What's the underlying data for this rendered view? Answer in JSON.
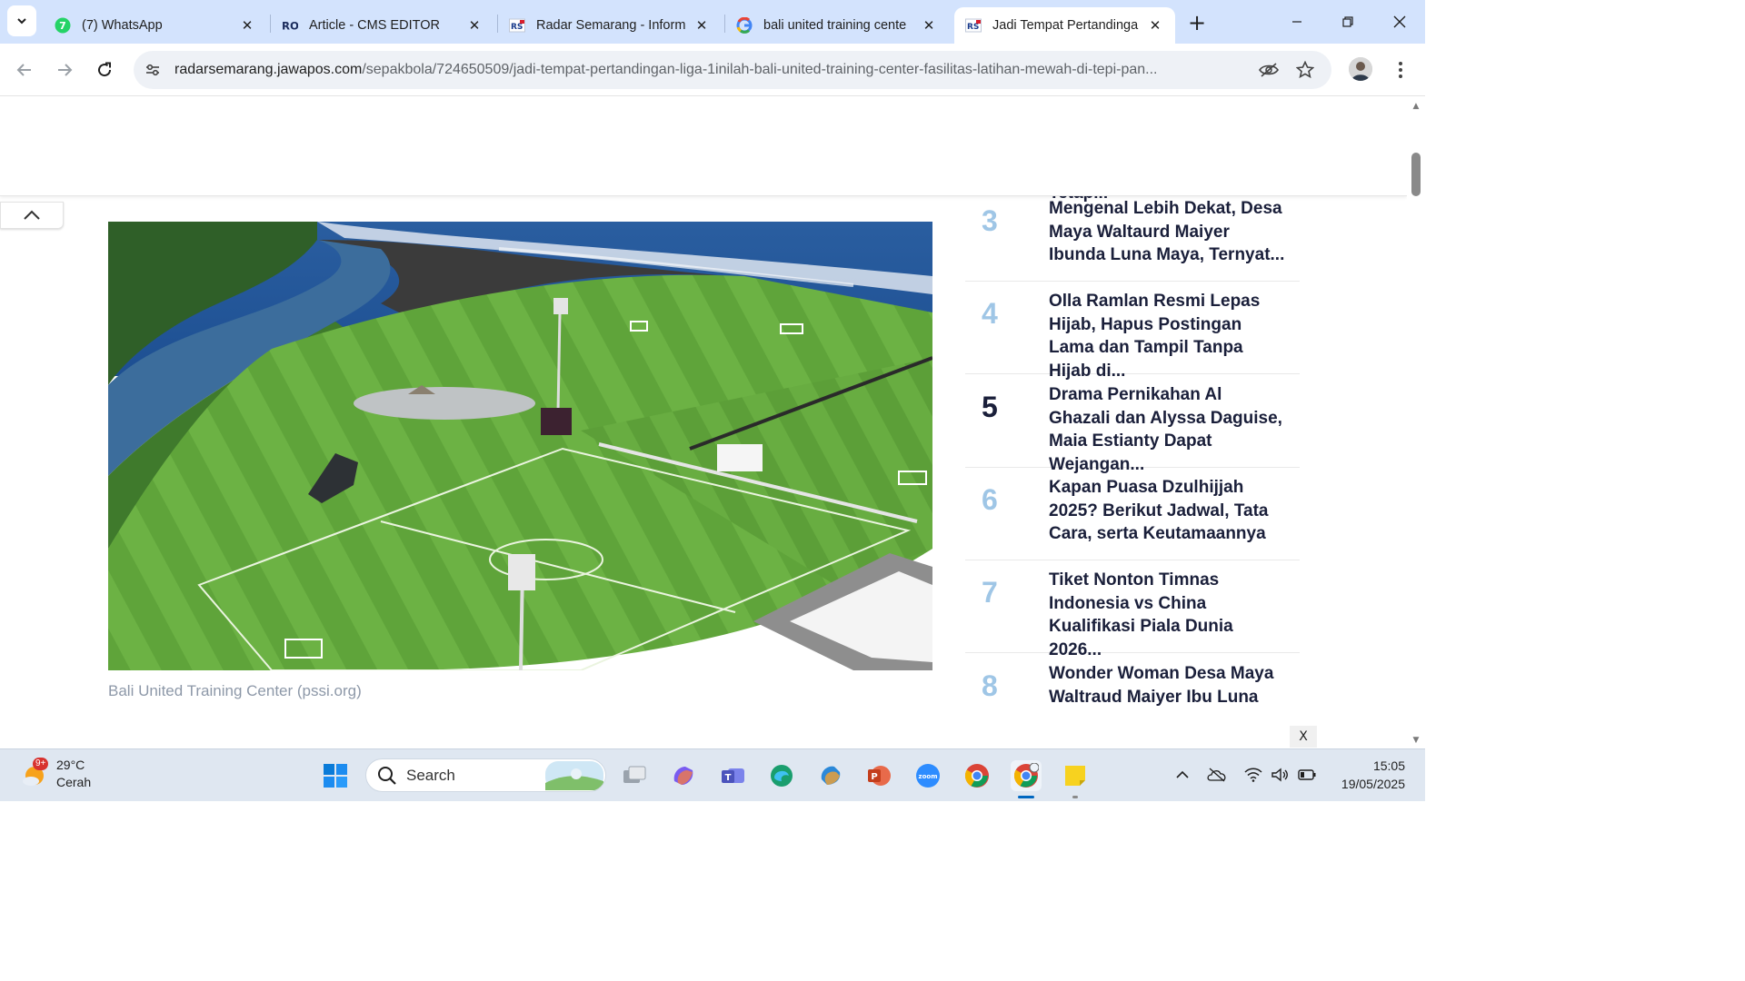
{
  "browser": {
    "tabs": [
      {
        "title": "(7) WhatsApp",
        "favicon": "whatsapp-icon",
        "active": false
      },
      {
        "title": "Article - CMS EDITOR",
        "favicon": "ro-icon",
        "active": false
      },
      {
        "title": "Radar Semarang - Inform",
        "favicon": "rs-icon",
        "active": false
      },
      {
        "title": "bali united training cente",
        "favicon": "google-icon",
        "active": false
      },
      {
        "title": "Jadi Tempat Pertandingan",
        "favicon": "rs-icon",
        "active": true
      }
    ],
    "close_glyph": "✕",
    "new_tab_glyph": "+",
    "url_host": "radarsemarang.jawapos.com",
    "url_path": "/sepakbola/724650509/jadi-tempat-pertandingan-liga-1inilah-bali-united-training-center-fasilitas-latihan-mewah-di-tepi-pan..."
  },
  "article": {
    "image_caption": "Bali United Training Center (pssi.org)"
  },
  "trending": {
    "items": [
      {
        "num": "",
        "title": "Komersial, Tapi Harus Tetap..."
      },
      {
        "num": "3",
        "title": "Mengenal Lebih Dekat, Desa Maya Waltaurd Maiyer Ibunda Luna Maya, Ternyat..."
      },
      {
        "num": "4",
        "title": "Olla Ramlan Resmi Lepas Hijab, Hapus Postingan Lama dan Tampil Tanpa Hijab di..."
      },
      {
        "num": "5",
        "title": "Drama Pernikahan Al Ghazali dan Alyssa Daguise, Maia Estianty Dapat Wejangan..."
      },
      {
        "num": "6",
        "title": "Kapan Puasa Dzulhijjah 2025? Berikut Jadwal, Tata Cara, serta Keutamaannya"
      },
      {
        "num": "7",
        "title": "Tiket Nonton Timnas Indonesia vs China Kualifikasi Piala Dunia 2026..."
      },
      {
        "num": "8",
        "title": "Wonder Woman Desa Maya Waltraud Maiyer Ibu Luna"
      }
    ],
    "close_label": "X"
  },
  "taskbar": {
    "weather_temp": "29°C",
    "weather_desc": "Cerah",
    "weather_badge": "9+",
    "search_label": "Search",
    "time": "15:05",
    "date": "19/05/2025"
  },
  "colors": {
    "tabstrip": "#d3e3fd",
    "trend_number_light": "#9fc6e6",
    "trend_number_dark": "#1a1f3a",
    "caption": "#8d98a8"
  }
}
